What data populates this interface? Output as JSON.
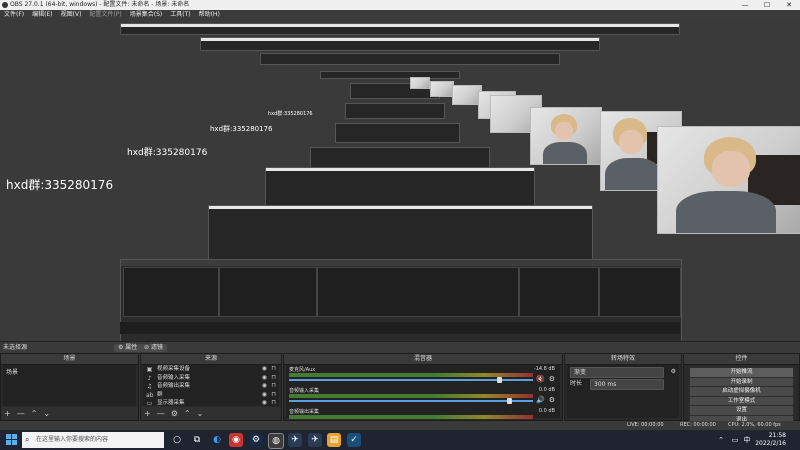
{
  "window": {
    "title": "OBS 27.0.1 (64-bit, windows) - 配置文件: 未命名 - 场景: 未命名",
    "controls": [
      "—",
      "☐",
      "✕"
    ]
  },
  "menu": [
    "文件(F)",
    "编辑(E)",
    "视图(V)",
    "配置文件(P)",
    "场景集合(S)",
    "工具(T)",
    "帮助(H)"
  ],
  "preview": {
    "overlay_texts": [
      "hxd群:335280176",
      "hxd群:335280176",
      "hxd群:335280176",
      "hxd群:335280176"
    ]
  },
  "scene_bar": {
    "current_scene": "未选择源",
    "properties_label": "⚙ 属性",
    "filters_label": "⊘ 滤镜"
  },
  "scenes": {
    "header": "场景",
    "items": [
      "场景"
    ]
  },
  "sources": {
    "header": "来源",
    "items": [
      {
        "icon": "camera-icon",
        "glyph": "▣",
        "label": "视频采集设备"
      },
      {
        "icon": "microphone-icon",
        "glyph": "♪",
        "label": "音频输入采集"
      },
      {
        "icon": "speaker-icon",
        "glyph": "♫",
        "label": "音频输出采集"
      },
      {
        "icon": "text-icon",
        "glyph": "ab",
        "label": "群"
      },
      {
        "icon": "monitor-icon",
        "glyph": "▭",
        "label": "显示器采集"
      }
    ]
  },
  "mixer": {
    "header": "混音器",
    "channels": [
      {
        "name": "麦克风/Aux",
        "db": "-14.8 dB",
        "fader": 0.86
      },
      {
        "name": "音频输入采集",
        "db": "0.0 dB",
        "fader": 0.9
      },
      {
        "name": "音频输出采集",
        "db": "0.0 dB",
        "fader": 0.9
      }
    ]
  },
  "transitions": {
    "header": "转场特效",
    "type_value": "渐变",
    "duration_label": "时长",
    "duration_value": "300 ms"
  },
  "controls": {
    "header": "控件",
    "buttons": [
      "开始推流",
      "开始录制",
      "启动虚拟摄像机",
      "工作室模式",
      "设置",
      "退出"
    ]
  },
  "status": {
    "live": "LIVE: 00:00:00",
    "rec": "REC: 00:00:00",
    "cpu": "CPU: 2.0%, 60.00 fps"
  },
  "taskbar": {
    "search_placeholder": "在这里输入你要搜索的内容",
    "time": "21:58",
    "date": "2022/2/16",
    "input_method": "中"
  },
  "colors": {
    "accent_blue": "#5aa0e0",
    "meter_green": "#4c8c34",
    "taskbar_bg": "#1f2430"
  }
}
